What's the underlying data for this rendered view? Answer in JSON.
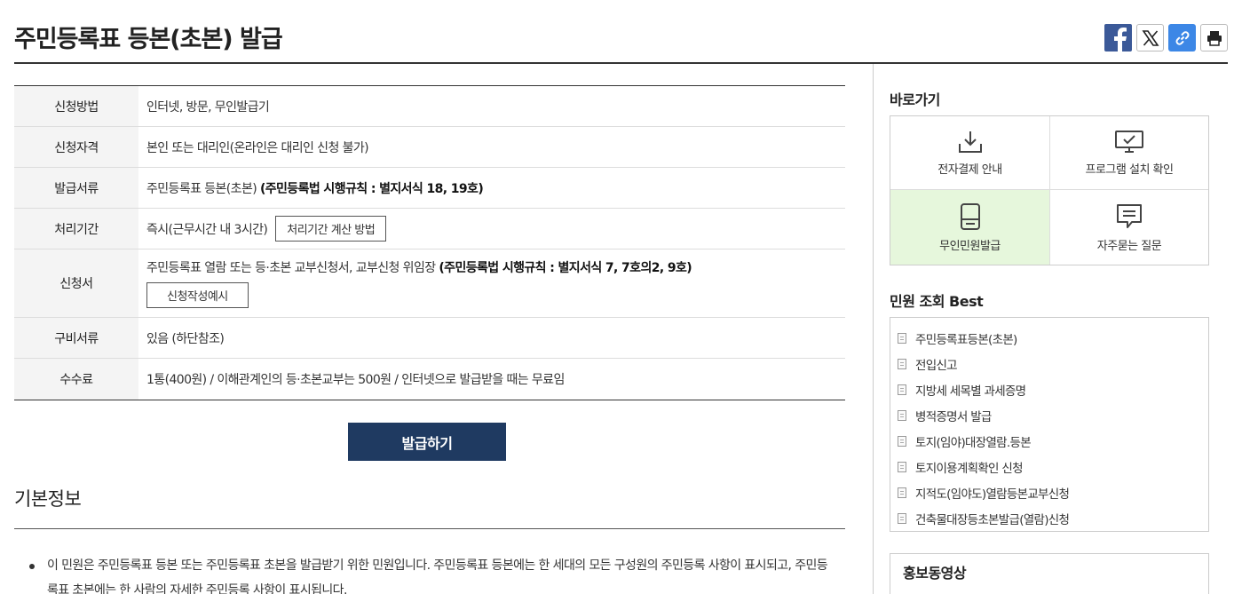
{
  "page": {
    "title": "주민등록표 등본(초본) 발급"
  },
  "share": {
    "icons": [
      "facebook-icon",
      "x-icon",
      "link-icon",
      "print-icon"
    ]
  },
  "info": {
    "rows": [
      {
        "label": "신청방법",
        "value": "인터넷, 방문, 무인발급기"
      },
      {
        "label": "신청자격",
        "value": "본인 또는 대리인(온라인은 대리인 신청 불가)"
      },
      {
        "label": "발급서류",
        "value_plain": "주민등록표 등본(초본) ",
        "value_bold": "(주민등록법 시행규칙 : 별지서식 18, 19호)"
      },
      {
        "label": "처리기간",
        "value": "즉시(근무시간 내 3시간)",
        "button": "처리기간 계산 방법"
      },
      {
        "label": "신청서",
        "value_plain": "주민등록표 열람 또는 등·초본 교부신청서, 교부신청 위임장 ",
        "value_bold": "(주민등록법 시행규칙 : 별지서식 7, 7호의2, 9호)",
        "button": "신청작성예시"
      },
      {
        "label": "구비서류",
        "value": "있음 (하단참조)"
      },
      {
        "label": "수수료",
        "value": "1통(400원) / 이해관계인의 등·초본교부는 500원 / 인터넷으로 발급받을 때는 무료임"
      }
    ]
  },
  "issue_button": "발급하기",
  "basic": {
    "title": "기본정보",
    "text": "이 민원은 주민등록표 등본 또는 주민등록표 초본을 발급받기 위한 민원입니다. 주민등록표 등본에는 한 세대의 모든 구성원의 주민등록 사항이 표시되고, 주민등록표 초본에는 한 사람의 자세한 주민등록 사항이 표시됩니다."
  },
  "quick": {
    "title": "바로가기",
    "items": [
      {
        "label": "전자결제 안내",
        "icon": "download-icon"
      },
      {
        "label": "프로그램 설치 확인",
        "icon": "monitor-check-icon"
      },
      {
        "label": "무인민원발급",
        "icon": "kiosk-icon"
      },
      {
        "label": "자주묻는 질문",
        "icon": "speech-bubble-icon"
      }
    ],
    "active_color": "#e6f7dc"
  },
  "best": {
    "title": "민원 조회 Best",
    "items": [
      "주민등록표등본(초본)",
      "전입신고",
      "지방세 세목별 과세증명",
      "병적증명서 발급",
      "토지(임야)대장열람.등본",
      "토지이용계획확인 신청",
      "지적도(임야도)열람등본교부신청",
      "건축물대장등초본발급(열람)신청"
    ]
  },
  "promo": {
    "title": "홍보동영상"
  },
  "colors": {
    "primary_button": "#1f3a61",
    "facebook": "#3b5998",
    "link": "#3c87e6"
  }
}
